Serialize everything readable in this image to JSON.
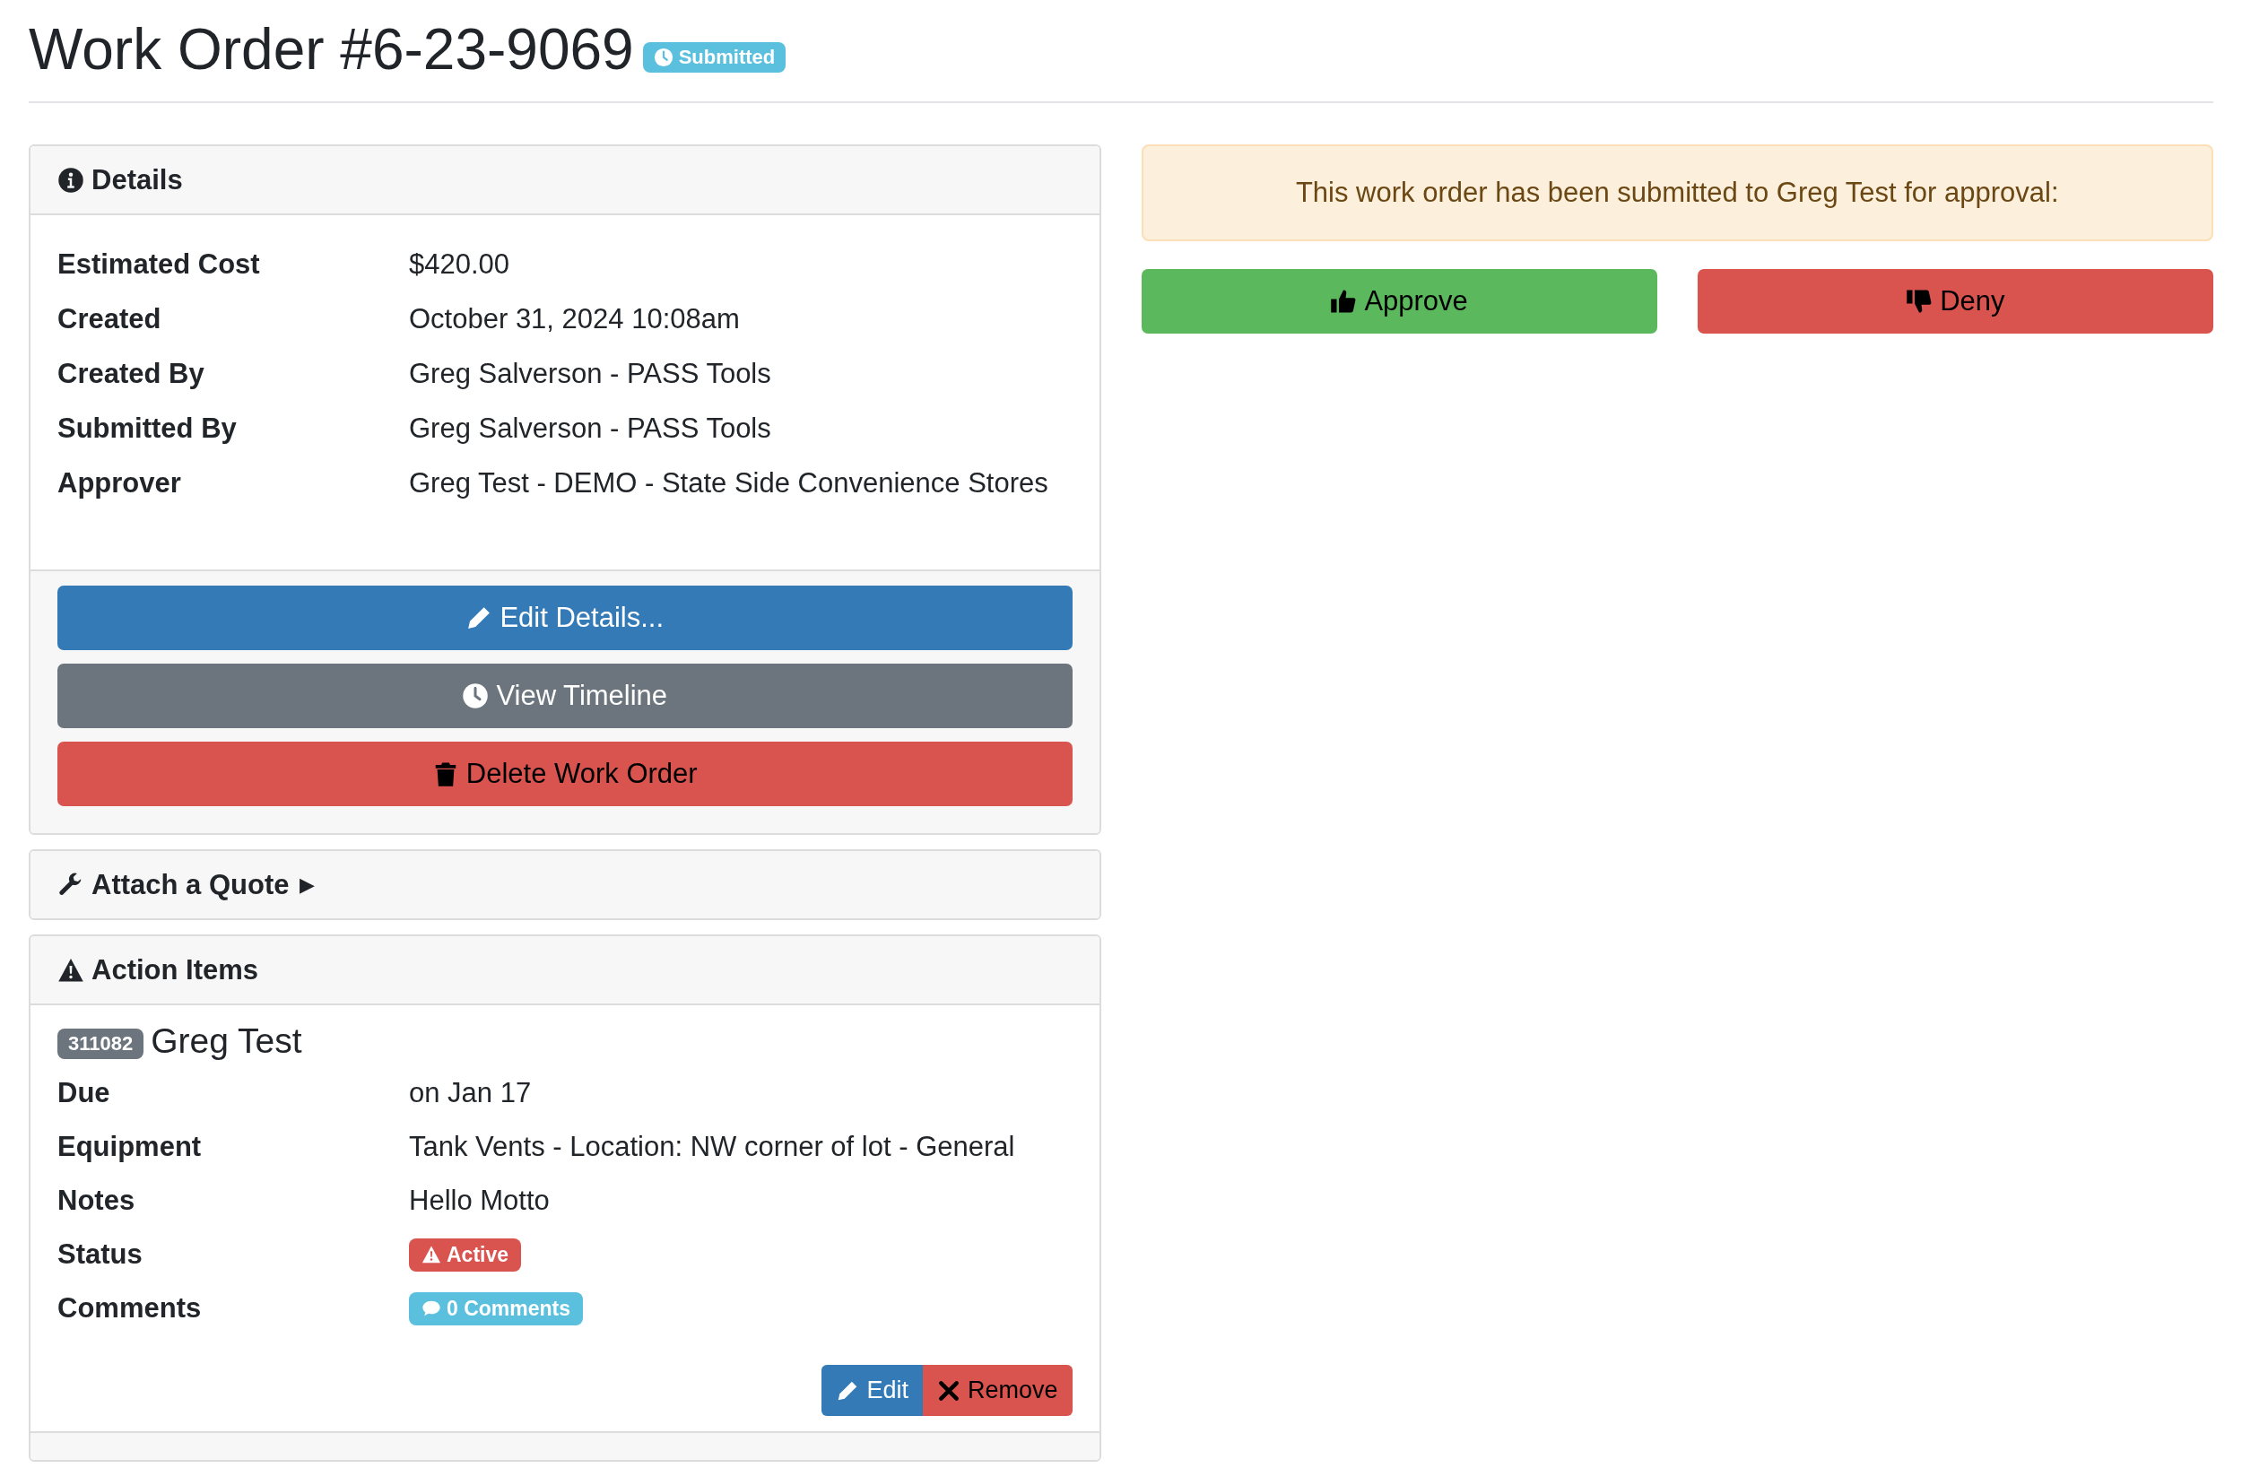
{
  "header": {
    "title": "Work Order #6-23-9069",
    "status": "Submitted"
  },
  "details": {
    "title": "Details",
    "fields": [
      {
        "label": "Estimated Cost",
        "value": "$420.00"
      },
      {
        "label": "Created",
        "value": "October 31, 2024 10:08am"
      },
      {
        "label": "Created By",
        "value": "Greg Salverson - PASS Tools"
      },
      {
        "label": "Submitted By",
        "value": "Greg Salverson - PASS Tools"
      },
      {
        "label": "Approver",
        "value": "Greg Test - DEMO - State Side Convenience Stores"
      }
    ],
    "buttons": [
      "Edit Details...",
      "View Timeline",
      "Delete Work Order"
    ]
  },
  "quote_panel": {
    "title": "Attach a Quote",
    "toggle": "▶"
  },
  "action_items": {
    "title": "Action Items",
    "items": [
      {
        "id": "311082",
        "assignee": "Greg Test",
        "fields": [
          {
            "label": "Due",
            "kind": "text",
            "value": "on Jan 17"
          },
          {
            "label": "Equipment",
            "kind": "text",
            "value": "Tank Vents - Location: NW corner of lot - General"
          },
          {
            "label": "Notes",
            "kind": "text",
            "value": "Hello Motto"
          },
          {
            "label": "Status",
            "kind": "status",
            "value": "Active"
          },
          {
            "label": "Comments",
            "kind": "comments",
            "value": "0 Comments"
          }
        ],
        "buttons": [
          "Edit",
          "Remove"
        ]
      }
    ]
  },
  "approval": {
    "message": "This work order has been submitted to Greg Test for approval:",
    "buttons": [
      "Approve",
      "Deny"
    ]
  }
}
